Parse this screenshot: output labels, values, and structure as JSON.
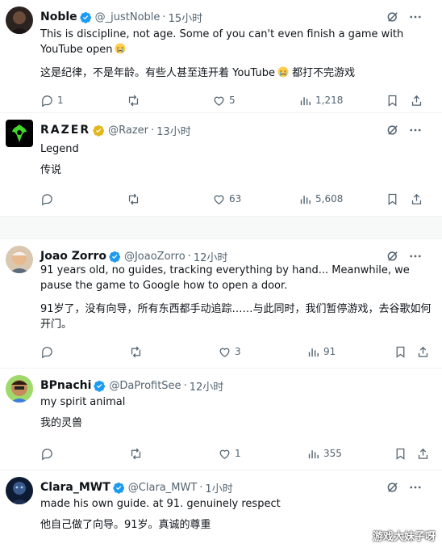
{
  "tweets": [
    {
      "name": "Noble",
      "handle": "@_justNoble",
      "time": "15小时",
      "text_en": "This is discipline, not age. Some of you can't even finish a game with YouTube open",
      "text_cn": "这是纪律，不是年龄。有些人甚至连开着 YouTube",
      "text_cn_tail": "都打不完游戏",
      "replies": "1",
      "reposts": "",
      "likes": "5",
      "views": "1,218",
      "avatar_icon": "noble-avatar"
    },
    {
      "name": "RAZER",
      "handle": "@Razer",
      "time": "13小时",
      "text_en": "Legend",
      "text_cn": "传说",
      "replies": "",
      "reposts": "",
      "likes": "63",
      "views": "5,608",
      "avatar_icon": "razer-logo",
      "badge_color": "#e2b719"
    },
    {
      "name": "Joao Zorro",
      "handle": "@JoaoZorro",
      "time": "12小时",
      "text_en": "91 years old, no guides, tracking everything by hand... Meanwhile, we pause the game to Google how to open a door.",
      "text_cn": "91岁了，没有向导，所有东西都手动追踪……与此同时，我们暂停游戏，去谷歌如何开门。",
      "replies": "",
      "reposts": "",
      "likes": "3",
      "views": "91",
      "avatar_icon": "joao-avatar"
    },
    {
      "name": "BPnachi",
      "handle": "@DaProfitSee",
      "time": "12小时",
      "text_en": "my spirit animal",
      "text_cn": "我的灵兽",
      "replies": "",
      "reposts": "",
      "likes": "1",
      "views": "355",
      "avatar_icon": "bpnachi-avatar"
    },
    {
      "name": "Clara_MWT",
      "handle": "@Clara_MWT",
      "time": "1小时",
      "text_en": "made his own guide. at 91. genuinely respect",
      "text_cn": "他自己做了向导。91岁。真诚的尊重",
      "avatar_icon": "clara-avatar"
    }
  ],
  "separator": "·",
  "watermark": "游戏大妹子呀",
  "colors": {
    "verified": "#1d9bf0",
    "gold_badge": "#e2b719",
    "muted": "#536471",
    "text": "#0f1419"
  }
}
